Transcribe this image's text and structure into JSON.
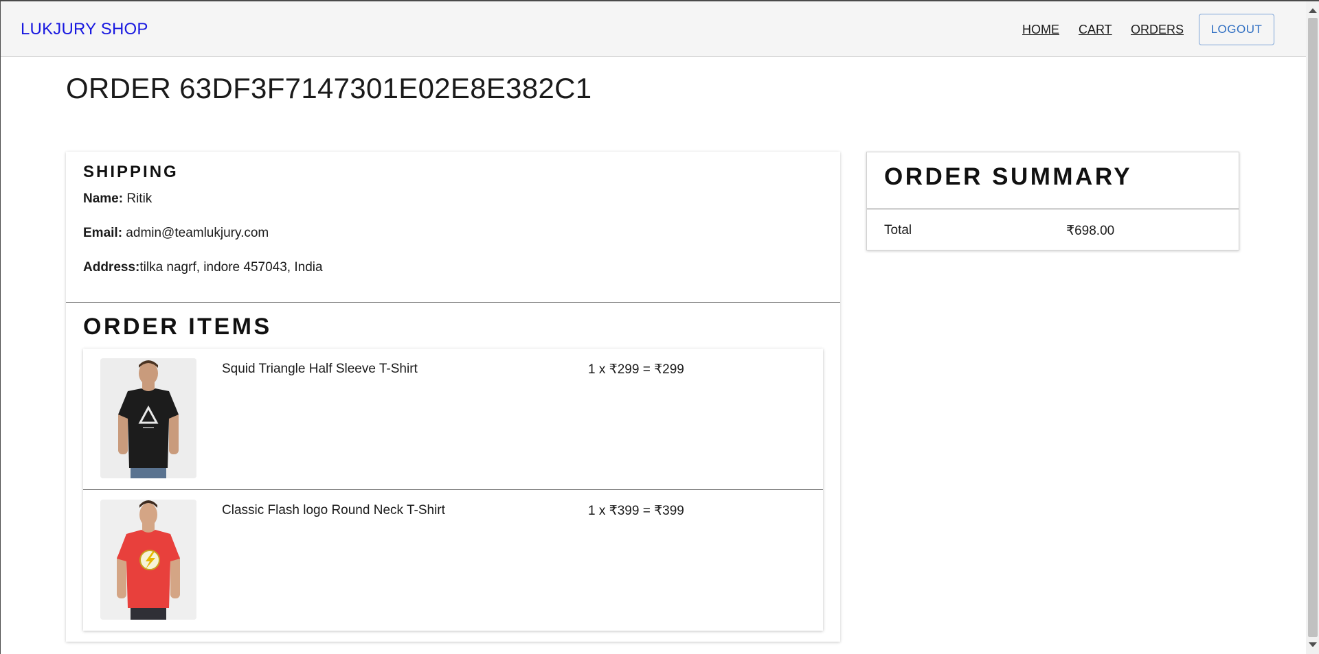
{
  "header": {
    "brand": "LUKJURY SHOP",
    "nav": {
      "home": "HOME",
      "cart": "CART",
      "orders": "ORDERS"
    },
    "logout_label": "LOGOUT",
    "colors": {
      "brand": "#1818e0",
      "logout": "#2e6ec2"
    }
  },
  "page": {
    "title": "ORDER 63DF3F7147301E02E8E382C1"
  },
  "shipping": {
    "heading": "SHIPPING",
    "name_label": "Name:",
    "name_value": " Ritik",
    "email_label": "Email:",
    "email_value": " admin@teamlukjury.com",
    "address_label": "Address:",
    "address_value": "tilka nagrf, indore 457043, India"
  },
  "order_items": {
    "heading": "ORDER ITEMS",
    "items": [
      {
        "name": "Squid Triangle Half Sleeve T-Shirt",
        "price_line": "1 x ₹299 = ₹299",
        "shirt_color": "#1c1c1c",
        "image_icon": "tshirt-photo-triangle"
      },
      {
        "name": "Classic Flash logo Round Neck T-Shirt",
        "price_line": "1 x ₹399 = ₹399",
        "shirt_color": "#e8403c",
        "image_icon": "tshirt-photo-flash"
      }
    ]
  },
  "summary": {
    "heading": "ORDER SUMMARY",
    "total_label": "Total",
    "total_value": "₹698.00"
  }
}
